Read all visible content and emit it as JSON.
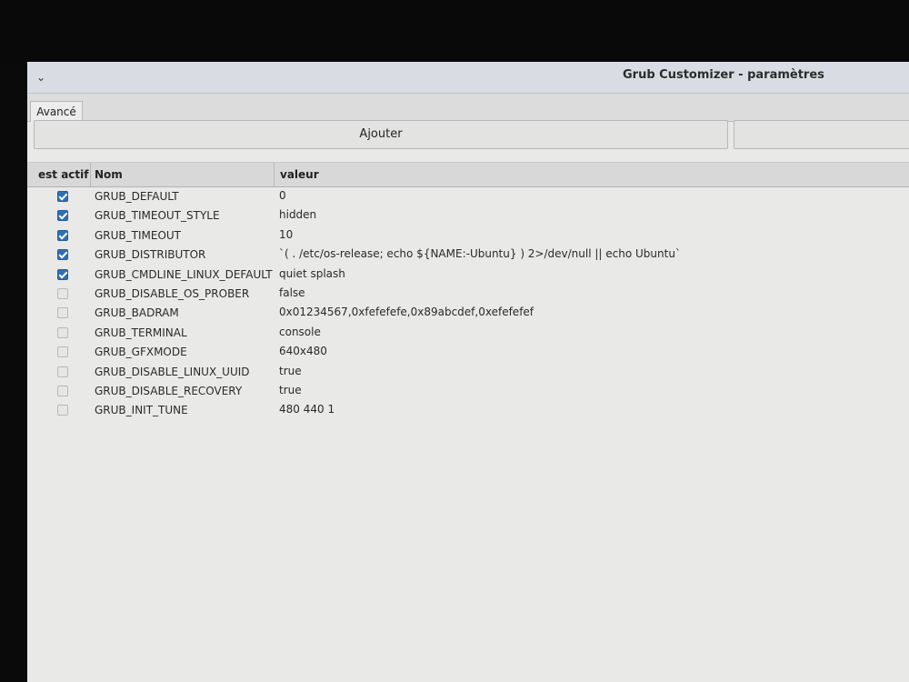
{
  "window": {
    "title": "Grub Customizer - paramètres",
    "menu_glyph": "⌄"
  },
  "tabs": [
    {
      "label": "Avancé",
      "active": true
    }
  ],
  "toolbar": {
    "add_label": "Ajouter"
  },
  "table": {
    "columns": [
      "est actif",
      "Nom",
      "valeur"
    ],
    "rows": [
      {
        "active": true,
        "name": "GRUB_DEFAULT",
        "value": "0"
      },
      {
        "active": true,
        "name": "GRUB_TIMEOUT_STYLE",
        "value": "hidden"
      },
      {
        "active": true,
        "name": "GRUB_TIMEOUT",
        "value": "10"
      },
      {
        "active": true,
        "name": "GRUB_DISTRIBUTOR",
        "value": "`( . /etc/os-release; echo ${NAME:-Ubuntu} ) 2>/dev/null || echo Ubuntu`"
      },
      {
        "active": true,
        "name": "GRUB_CMDLINE_LINUX_DEFAULT",
        "value": "quiet splash"
      },
      {
        "active": false,
        "name": "GRUB_DISABLE_OS_PROBER",
        "value": "false"
      },
      {
        "active": false,
        "name": "GRUB_BADRAM",
        "value": "0x01234567,0xfefefefe,0x89abcdef,0xefefefef"
      },
      {
        "active": false,
        "name": "GRUB_TERMINAL",
        "value": "console"
      },
      {
        "active": false,
        "name": "GRUB_GFXMODE",
        "value": "640x480"
      },
      {
        "active": false,
        "name": "GRUB_DISABLE_LINUX_UUID",
        "value": "true"
      },
      {
        "active": false,
        "name": "GRUB_DISABLE_RECOVERY",
        "value": "true"
      },
      {
        "active": false,
        "name": "GRUB_INIT_TUNE",
        "value": "480 440 1"
      }
    ]
  }
}
